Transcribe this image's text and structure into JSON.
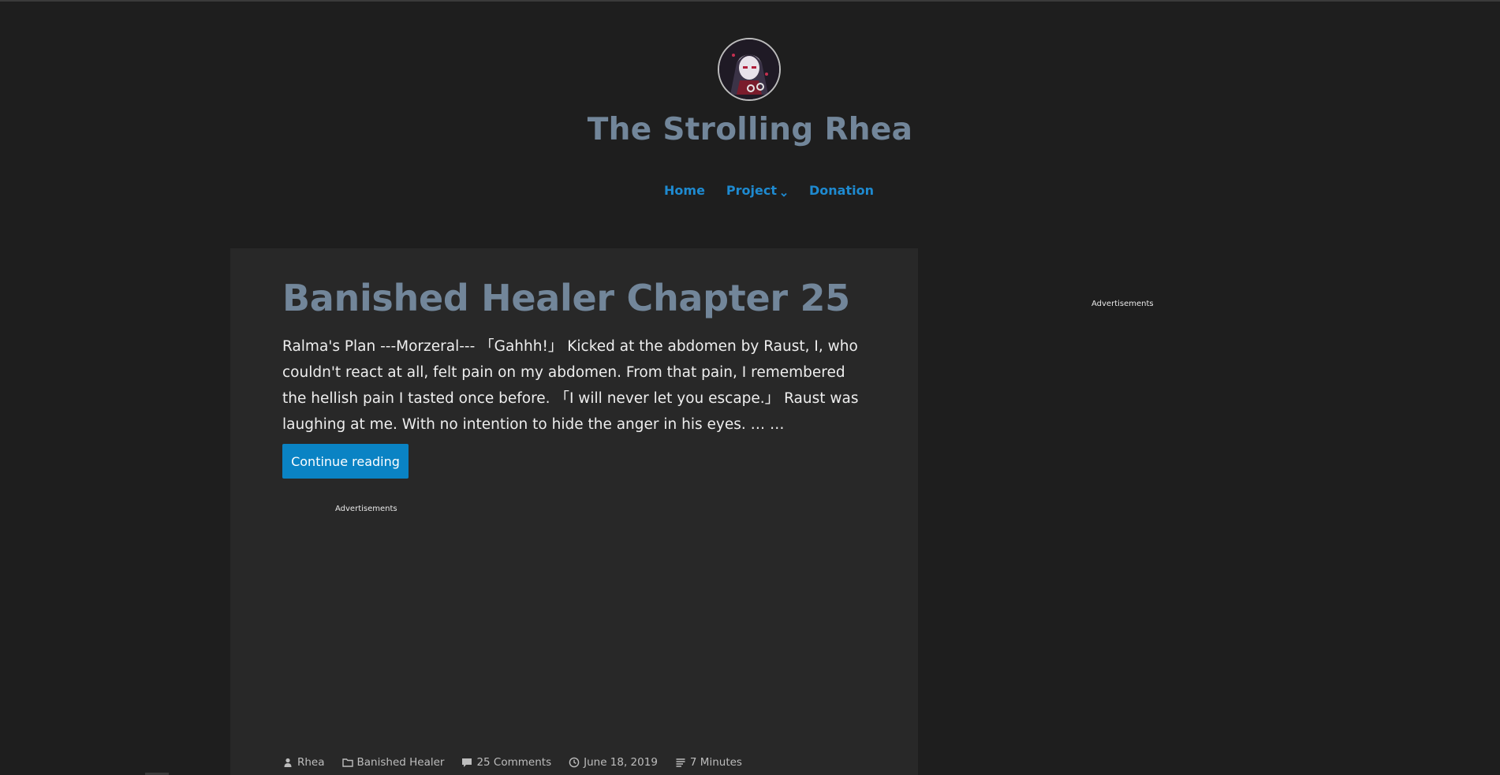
{
  "site": {
    "title": "The Strolling Rhea",
    "logo_icon": "avatar-anime-character"
  },
  "nav": {
    "items": [
      {
        "label": "Home"
      },
      {
        "label": "Project",
        "has_dropdown": true
      },
      {
        "label": "Donation"
      }
    ]
  },
  "post": {
    "title": "Banished Healer Chapter 25",
    "excerpt": "Ralma's Plan ---Morzeral--- 「Gahhh!」 Kicked at the abdomen by Raust, I, who couldn't react at all, felt pain on my abdomen. From that pain, I remembered the hellish pain I tasted once before. 「I will never let you escape.」 Raust was laughing at me. With no intention to hide the anger in his eyes. … …",
    "continue_label": "Continue reading",
    "ad_label": "Advertisements",
    "meta": {
      "author": "Rhea",
      "category": "Banished Healer",
      "comments": "25 Comments",
      "date": "June 18, 2019",
      "read_time": "7 Minutes"
    }
  },
  "sidebar": {
    "ad_label": "Advertisements"
  },
  "colors": {
    "background": "#1e1e1e",
    "card": "#282828",
    "title": "#72869a",
    "link": "#1e8ad0",
    "button": "#0a83c4"
  }
}
